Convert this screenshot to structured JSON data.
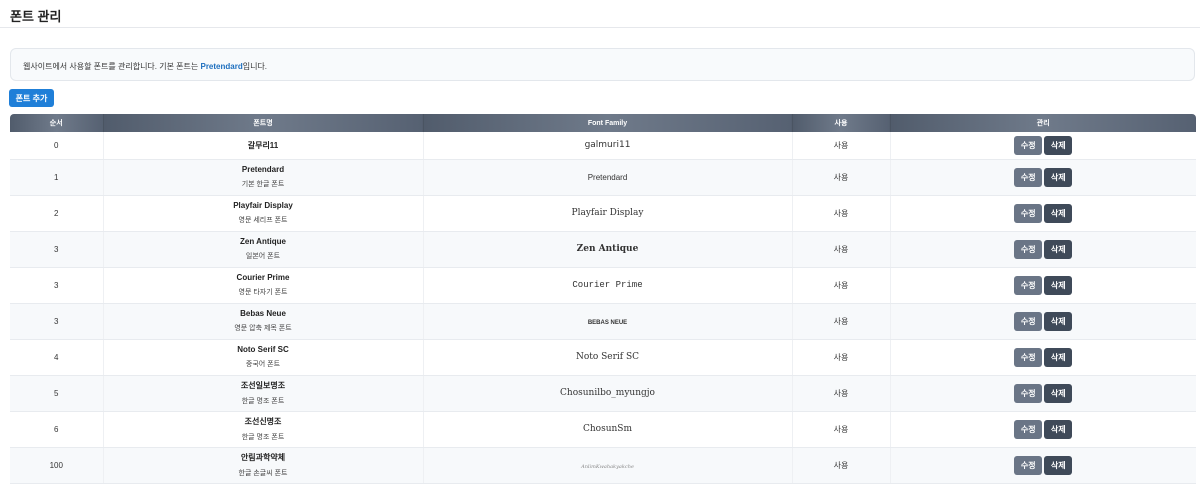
{
  "page": {
    "title": "폰트 관리"
  },
  "info": {
    "prefix": "웹사이트에서 사용할 폰트를 관리합니다. 기본 폰트는 ",
    "highlight": "Pretendard",
    "suffix": "입니다."
  },
  "toolbar": {
    "add_label": "폰트 추가"
  },
  "table": {
    "headers": {
      "order": "순서",
      "name": "폰트명",
      "family": "Font Family",
      "use": "사용",
      "manage": "관리"
    },
    "edit_label": "수정",
    "delete_label": "삭제",
    "rows": [
      {
        "order": "0",
        "name": "갈무리11",
        "desc": "",
        "family": "galmuri11",
        "use": "사용",
        "style": "sans"
      },
      {
        "order": "1",
        "name": "Pretendard",
        "desc": "기본 한글 폰트",
        "family": "Pretendard",
        "use": "사용",
        "style": "reg"
      },
      {
        "order": "2",
        "name": "Playfair Display",
        "desc": "영문 세리프 폰트",
        "family": "Playfair Display",
        "use": "사용",
        "style": "serif"
      },
      {
        "order": "3",
        "name": "Zen Antique",
        "desc": "일본어 폰트",
        "family": "Zen Antique",
        "use": "사용",
        "style": "serif-b"
      },
      {
        "order": "3",
        "name": "Courier Prime",
        "desc": "영문 타자기 폰트",
        "family": "Courier Prime",
        "use": "사용",
        "style": "mono"
      },
      {
        "order": "3",
        "name": "Bebas Neue",
        "desc": "영문 압축 제목 폰트",
        "family": "BEBAS NEUE",
        "use": "사용",
        "style": "cond"
      },
      {
        "order": "4",
        "name": "Noto Serif SC",
        "desc": "중국어 폰트",
        "family": "Noto Serif SC",
        "use": "사용",
        "style": "serif"
      },
      {
        "order": "5",
        "name": "조선일보명조",
        "desc": "한글 명조 폰트",
        "family": "Chosunilbo_myungjo",
        "use": "사용",
        "style": "serif"
      },
      {
        "order": "6",
        "name": "조선신명조",
        "desc": "한글 명조 폰트",
        "family": "ChosunSm",
        "use": "사용",
        "style": "serif"
      },
      {
        "order": "100",
        "name": "안림과학약체",
        "desc": "한글 손글씨 폰트",
        "family": "AnlimKwahakyakche",
        "use": "사용",
        "style": "tiny"
      }
    ]
  }
}
